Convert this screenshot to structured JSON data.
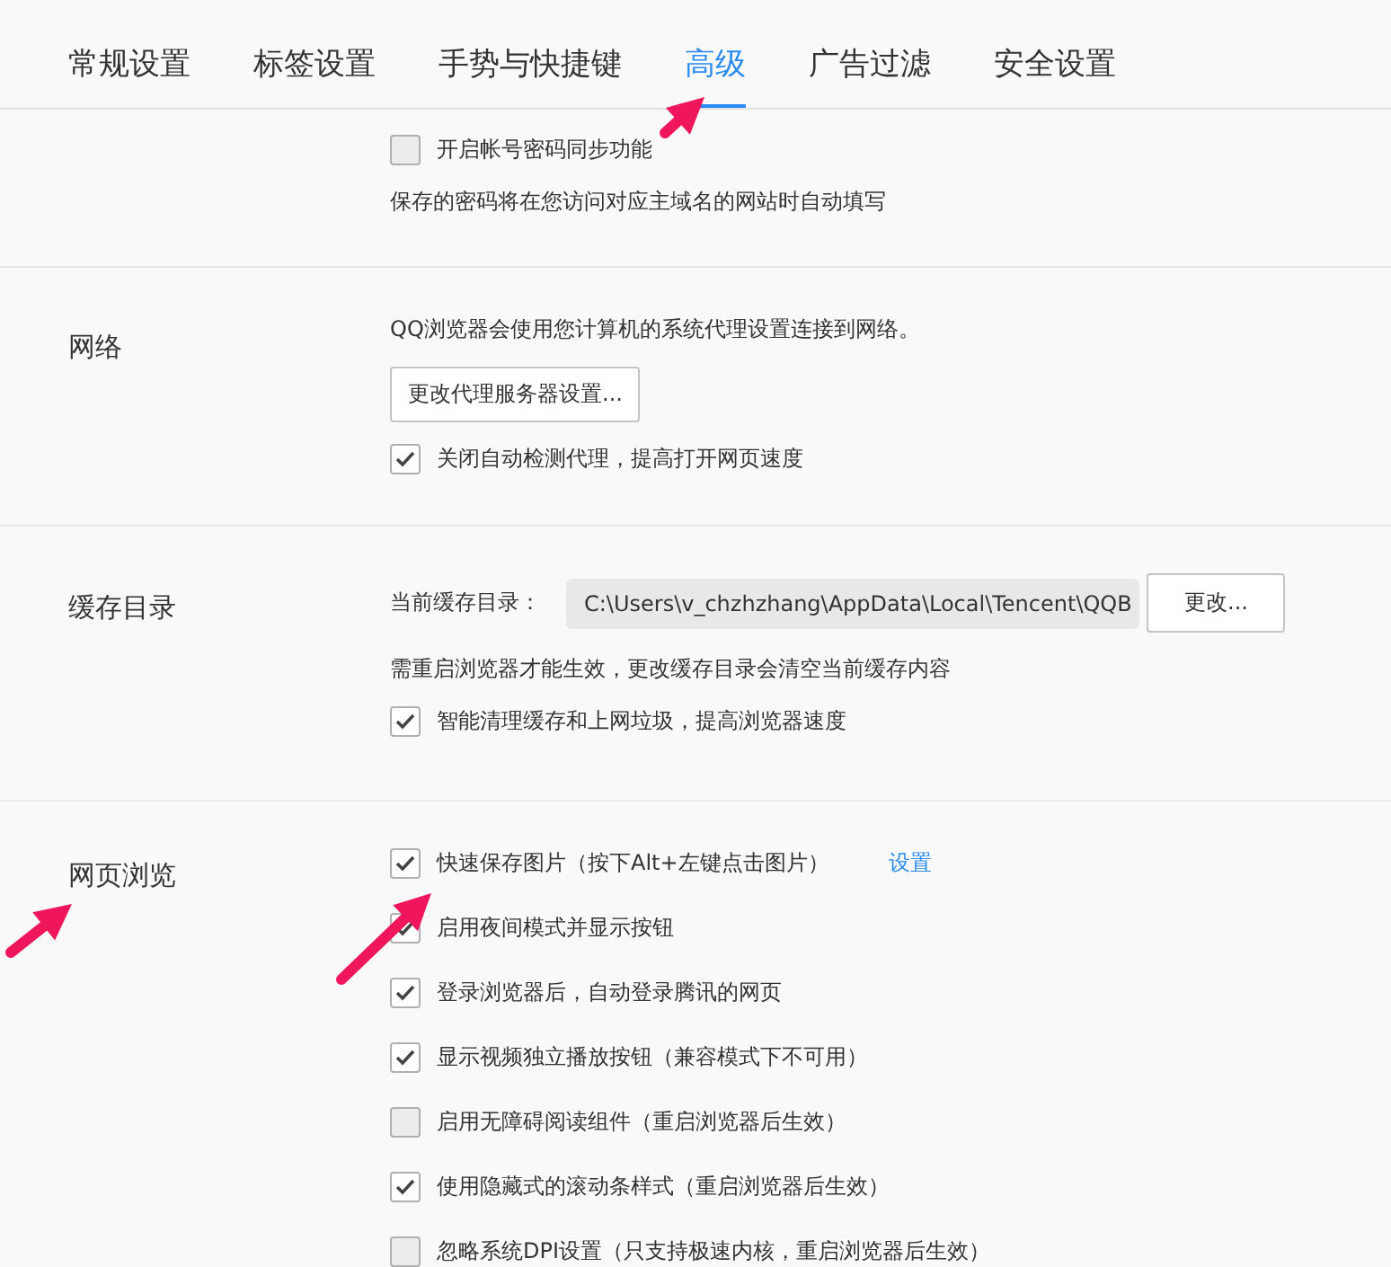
{
  "tabs": [
    {
      "label": "常规设置",
      "selected": false
    },
    {
      "label": "标签设置",
      "selected": false
    },
    {
      "label": "手势与快捷键",
      "selected": false
    },
    {
      "label": "高级",
      "selected": true
    },
    {
      "label": "广告过滤",
      "selected": false
    },
    {
      "label": "安全设置",
      "selected": false
    }
  ],
  "sections": [
    {
      "items": [
        {
          "kind": "checkbox",
          "label": "开启帐号密码同步功能",
          "checked": false
        },
        {
          "kind": "note",
          "text": "保存的密码将在您访问对应主域名的网站时自动填写"
        }
      ]
    },
    {
      "title": "网络",
      "items": [
        {
          "kind": "note",
          "text": "QQ浏览器会使用您计算机的系统代理设置连接到网络。"
        },
        {
          "kind": "button",
          "label": "更改代理服务器设置..."
        },
        {
          "kind": "checkbox",
          "label": "关闭自动检测代理，提高打开网页速度",
          "checked": true
        }
      ]
    },
    {
      "title": "缓存目录",
      "items": [
        {
          "kind": "path",
          "label": "当前缓存目录：",
          "value": "C:\\Users\\v_chzhzhang\\AppData\\Local\\Tencent\\QQB",
          "button": "更改..."
        },
        {
          "kind": "note",
          "text": "需重启浏览器才能生效，更改缓存目录会清空当前缓存内容"
        },
        {
          "kind": "checkbox",
          "label": "智能清理缓存和上网垃圾，提高浏览器速度",
          "checked": true
        }
      ]
    },
    {
      "title": "网页浏览",
      "items": [
        {
          "kind": "checkbox",
          "label": "快速保存图片（按下Alt+左键点击图片）",
          "checked": true,
          "link": "设置"
        },
        {
          "kind": "checkbox",
          "label": "启用夜间模式并显示按钮",
          "checked": true
        },
        {
          "kind": "checkbox",
          "label": "登录浏览器后，自动登录腾讯的网页",
          "checked": true
        },
        {
          "kind": "checkbox",
          "label": "显示视频独立播放按钮（兼容模式下不可用）",
          "checked": true
        },
        {
          "kind": "checkbox",
          "label": "启用无障碍阅读组件（重启浏览器后生效）",
          "checked": false
        },
        {
          "kind": "checkbox",
          "label": "使用隐藏式的滚动条样式（重启浏览器后生效）",
          "checked": true
        },
        {
          "kind": "checkbox",
          "label": "忽略系统DPI设置（只支持极速内核，重启浏览器后生效）",
          "checked": false
        }
      ]
    }
  ]
}
